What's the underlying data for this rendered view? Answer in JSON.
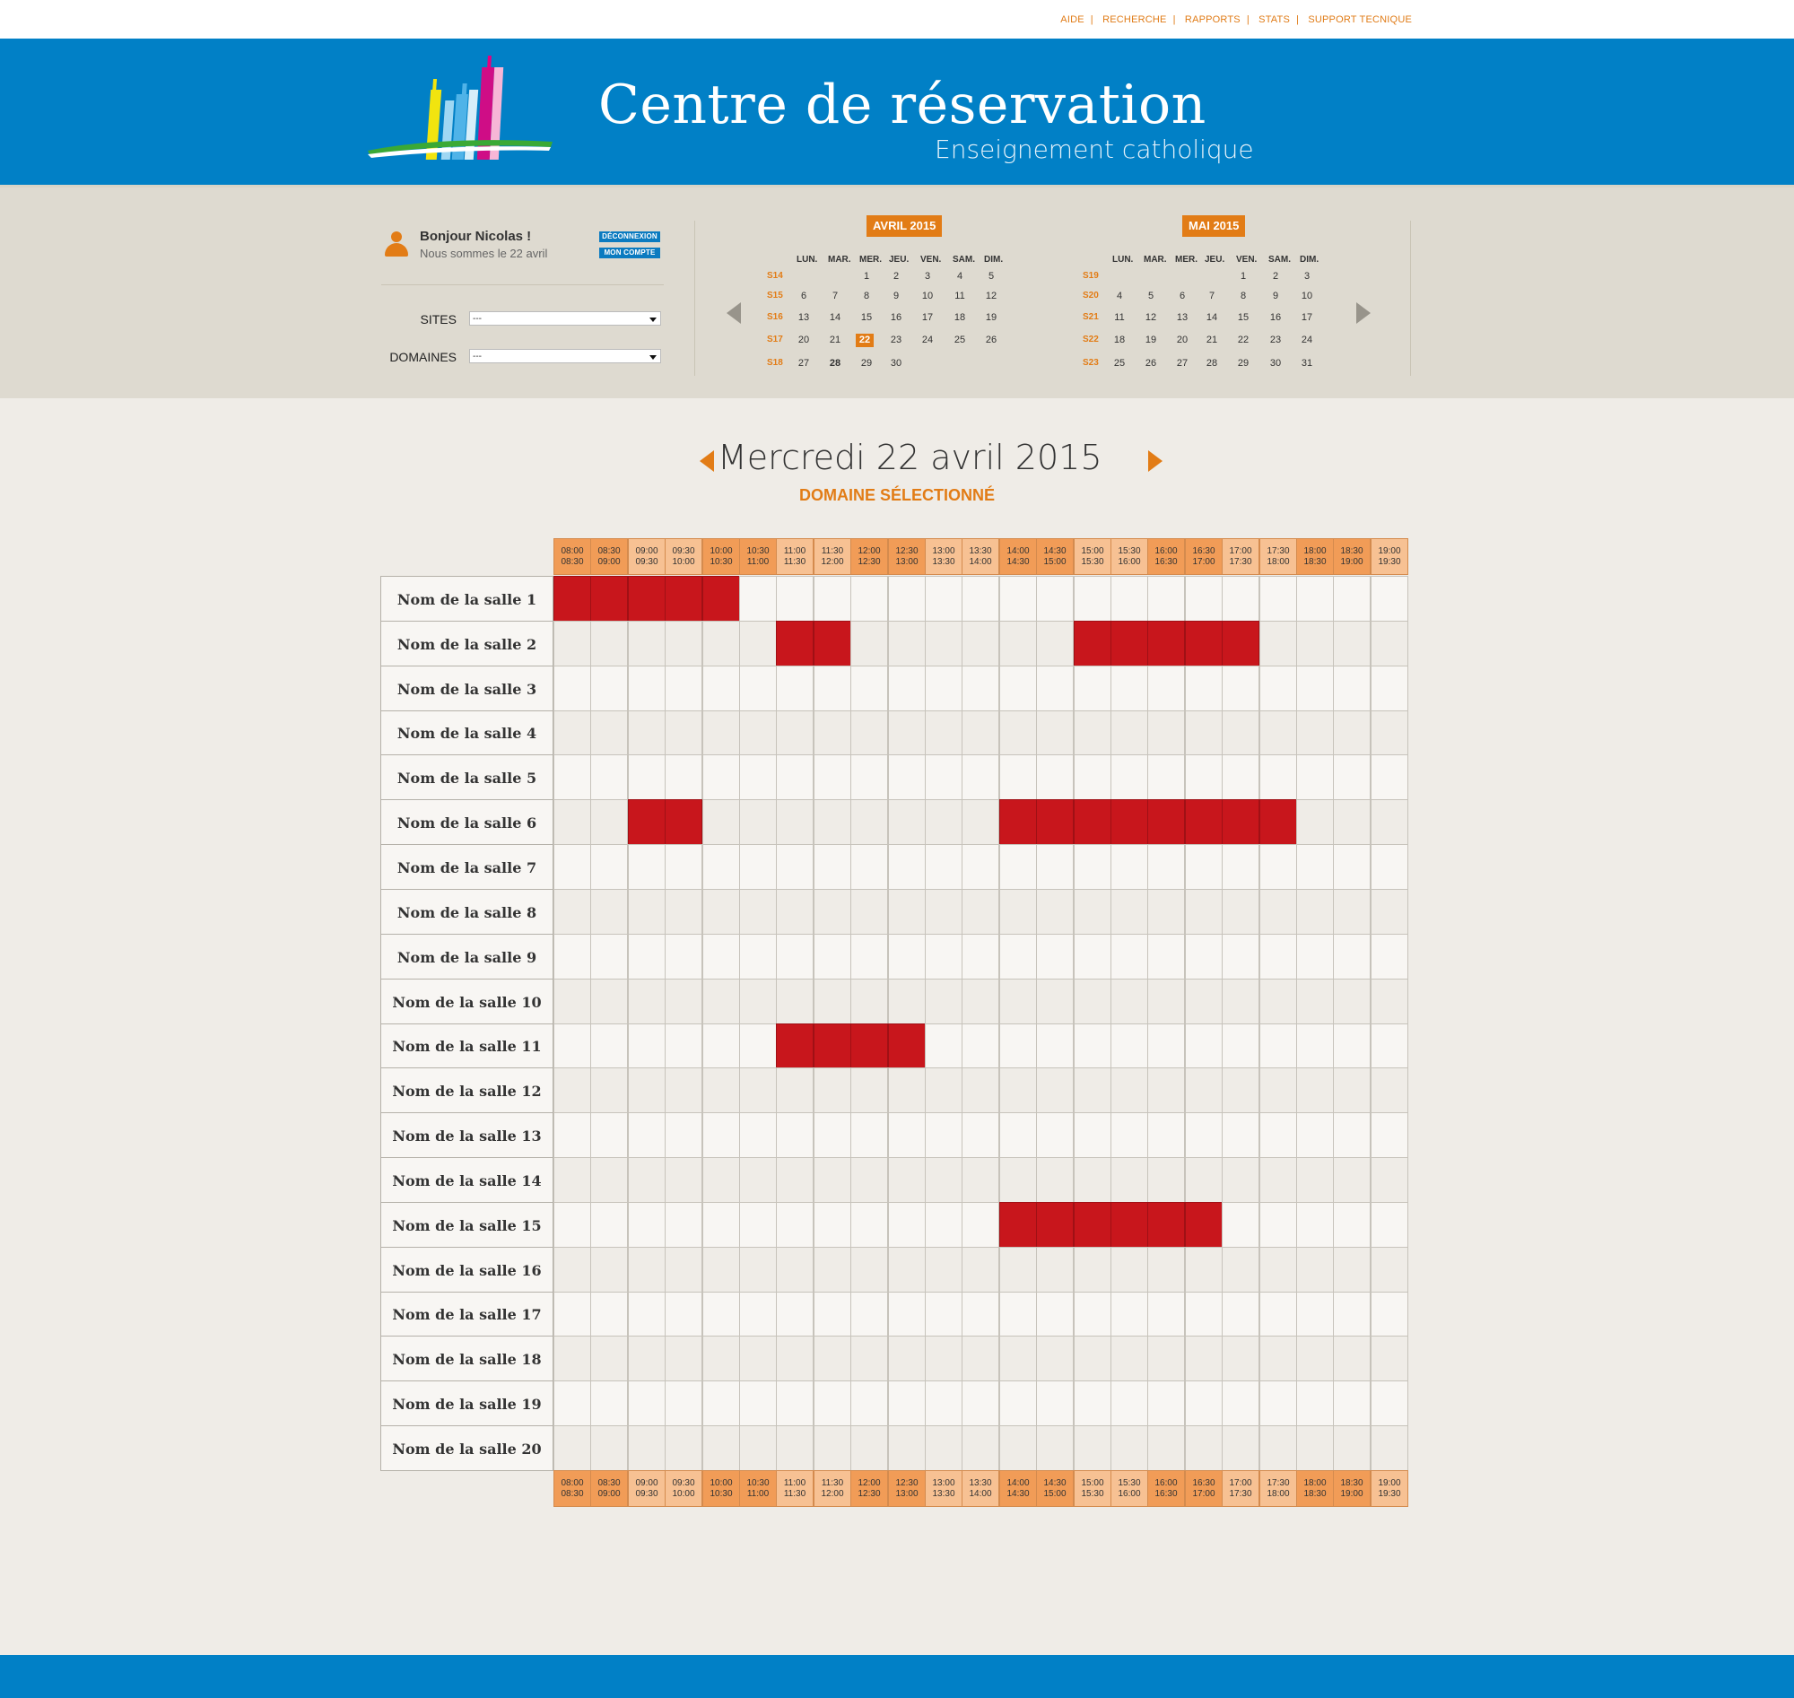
{
  "top_links": [
    "AIDE",
    "RECHERCHE",
    "RAPPORTS",
    "STATS",
    "SUPPORT TECNIQUE"
  ],
  "header": {
    "title": "Centre de réservation",
    "subtitle": "Enseignement catholique"
  },
  "user": {
    "greeting": "Bonjour Nicolas !",
    "today_text": "Nous sommes le 22 avril",
    "logout_label": "DÉCONNEXION",
    "account_label": "MON COMPTE"
  },
  "filters": {
    "sites_label": "SITES",
    "sites_value": "---",
    "domaines_label": "DOMAINES",
    "domaines_value": "---"
  },
  "calendars": [
    {
      "title": "AVRIL 2015",
      "days": [
        "LUN.",
        "MAR.",
        "MER.",
        "JEU.",
        "VEN.",
        "SAM.",
        "DIM."
      ],
      "weeks": [
        {
          "label": "S14",
          "dates": [
            "",
            "",
            "1",
            "2",
            "3",
            "4",
            "5"
          ]
        },
        {
          "label": "S15",
          "dates": [
            "6",
            "7",
            "8",
            "9",
            "10",
            "11",
            "12"
          ]
        },
        {
          "label": "S16",
          "dates": [
            "13",
            "14",
            "15",
            "16",
            "17",
            "18",
            "19"
          ]
        },
        {
          "label": "S17",
          "dates": [
            "20",
            "21",
            "22",
            "23",
            "24",
            "25",
            "26"
          ]
        },
        {
          "label": "S18",
          "dates": [
            "27",
            "28",
            "29",
            "30",
            "",
            "",
            ""
          ]
        }
      ],
      "selected": "22"
    },
    {
      "title": "MAI 2015",
      "days": [
        "LUN.",
        "MAR.",
        "MER.",
        "JEU.",
        "VEN.",
        "SAM.",
        "DIM."
      ],
      "weeks": [
        {
          "label": "S19",
          "dates": [
            "",
            "",
            "",
            "",
            "1",
            "2",
            "3"
          ]
        },
        {
          "label": "S20",
          "dates": [
            "4",
            "5",
            "6",
            "7",
            "8",
            "9",
            "10"
          ]
        },
        {
          "label": "S21",
          "dates": [
            "11",
            "12",
            "13",
            "14",
            "15",
            "16",
            "17"
          ]
        },
        {
          "label": "S22",
          "dates": [
            "18",
            "19",
            "20",
            "21",
            "22",
            "23",
            "24"
          ]
        },
        {
          "label": "S23",
          "dates": [
            "25",
            "26",
            "27",
            "28",
            "29",
            "30",
            "31"
          ]
        }
      ],
      "selected": ""
    }
  ],
  "schedule": {
    "date_title": "Mercredi 22 avril 2015",
    "domain_label": "DOMAINE SÉLECTIONNÉ",
    "slots": [
      [
        "08:00",
        "08:30"
      ],
      [
        "08:30",
        "09:00"
      ],
      [
        "09:00",
        "09:30"
      ],
      [
        "09:30",
        "10:00"
      ],
      [
        "10:00",
        "10:30"
      ],
      [
        "10:30",
        "11:00"
      ],
      [
        "11:00",
        "11:30"
      ],
      [
        "11:30",
        "12:00"
      ],
      [
        "12:00",
        "12:30"
      ],
      [
        "12:30",
        "13:00"
      ],
      [
        "13:00",
        "13:30"
      ],
      [
        "13:30",
        "14:00"
      ],
      [
        "14:00",
        "14:30"
      ],
      [
        "14:30",
        "15:00"
      ],
      [
        "15:00",
        "15:30"
      ],
      [
        "15:30",
        "16:00"
      ],
      [
        "16:00",
        "16:30"
      ],
      [
        "16:30",
        "17:00"
      ],
      [
        "17:00",
        "17:30"
      ],
      [
        "17:30",
        "18:00"
      ],
      [
        "18:00",
        "18:30"
      ],
      [
        "18:30",
        "19:00"
      ],
      [
        "19:00",
        "19:30"
      ]
    ],
    "rooms": [
      {
        "name": "Nom de la salle 1",
        "booked": [
          0,
          1,
          2,
          3,
          4
        ]
      },
      {
        "name": "Nom de la salle 2",
        "booked": [
          6,
          7,
          14,
          15,
          16,
          17,
          18
        ]
      },
      {
        "name": "Nom de la salle 3",
        "booked": []
      },
      {
        "name": "Nom de la salle 4",
        "booked": []
      },
      {
        "name": "Nom de la salle 5",
        "booked": []
      },
      {
        "name": "Nom de la salle 6",
        "booked": [
          2,
          3,
          12,
          13,
          14,
          15,
          16,
          17,
          18,
          19
        ]
      },
      {
        "name": "Nom de la salle 7",
        "booked": []
      },
      {
        "name": "Nom de la salle 8",
        "booked": []
      },
      {
        "name": "Nom de la salle 9",
        "booked": []
      },
      {
        "name": "Nom de la salle 10",
        "booked": []
      },
      {
        "name": "Nom de la salle 11",
        "booked": [
          6,
          7,
          8,
          9
        ]
      },
      {
        "name": "Nom de la salle 12",
        "booked": []
      },
      {
        "name": "Nom de la salle 13",
        "booked": []
      },
      {
        "name": "Nom de la salle 14",
        "booked": []
      },
      {
        "name": "Nom de la salle 15",
        "booked": [
          12,
          13,
          14,
          15,
          16,
          17
        ]
      },
      {
        "name": "Nom de la salle 16",
        "booked": []
      },
      {
        "name": "Nom de la salle 17",
        "booked": []
      },
      {
        "name": "Nom de la salle 18",
        "booked": []
      },
      {
        "name": "Nom de la salle 19",
        "booked": []
      },
      {
        "name": "Nom de la salle 20",
        "booked": []
      }
    ]
  },
  "colors": {
    "brand_blue": "#0180c6",
    "accent_orange": "#e27c16",
    "booked_red": "#c8161c",
    "header_orange_dark": "#f19c57",
    "header_orange_light": "#f7c193"
  }
}
